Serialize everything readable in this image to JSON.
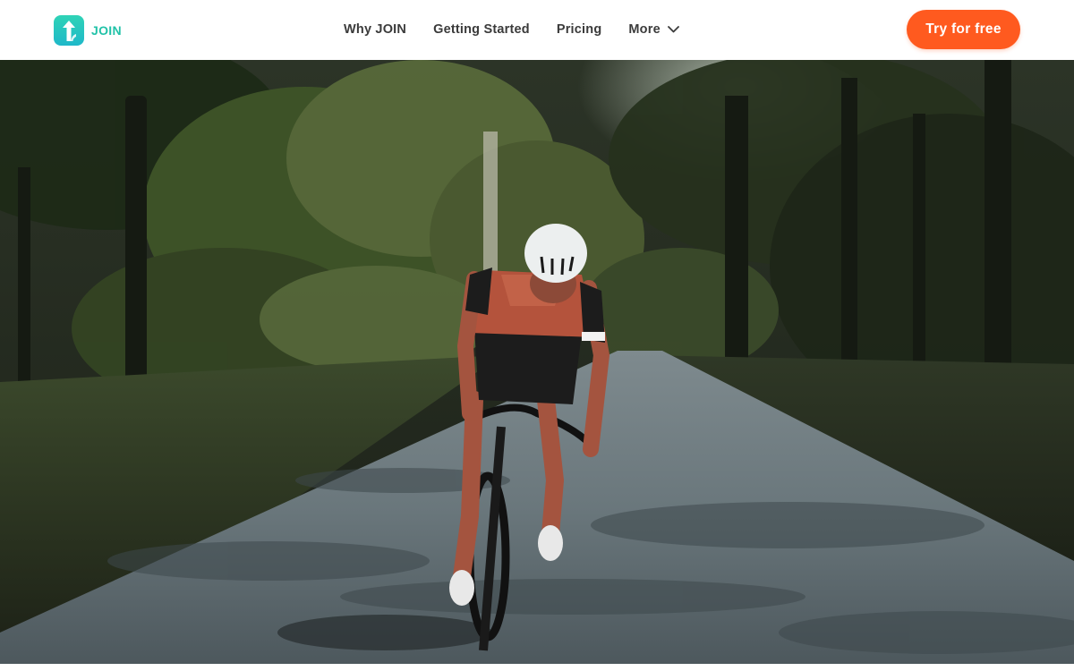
{
  "brand": {
    "name": "JOIN",
    "logo_icon": "join-logo-icon",
    "primary_color": "#21c2a8",
    "cta_color": "#ff5a1f"
  },
  "nav": {
    "items": [
      {
        "label": "Why JOIN"
      },
      {
        "label": "Getting Started"
      },
      {
        "label": "Pricing"
      },
      {
        "label": "More",
        "icon": "chevron-down-icon"
      }
    ]
  },
  "cta": {
    "label": "Try for free"
  },
  "hero": {
    "image": "cyclist-on-forest-road-photo"
  }
}
